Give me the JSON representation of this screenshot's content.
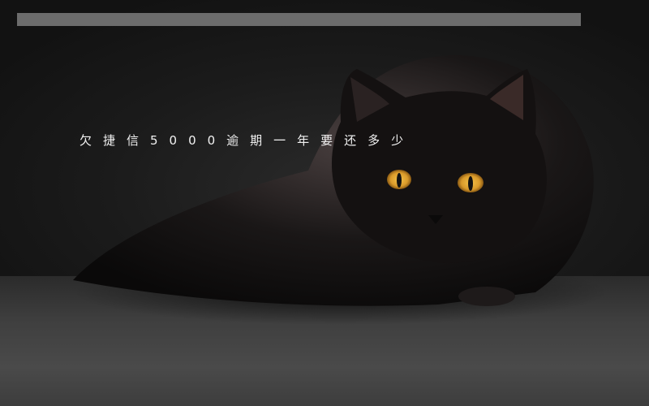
{
  "caption": {
    "text": "欠捷信5000逾期一年要还多少"
  },
  "image": {
    "subject_icon": "black-cat-photo",
    "colors": {
      "background": "#161616",
      "floor": "#444444",
      "top_bar": "#6c6c6c",
      "eyes": "#e0a43a",
      "caption": "#f2f2f2"
    }
  }
}
